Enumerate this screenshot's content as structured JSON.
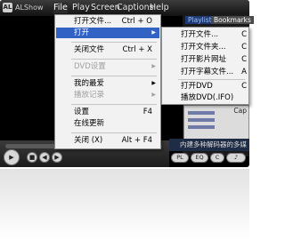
{
  "app": {
    "logo_text": "AL",
    "title": "ALShow"
  },
  "menubar": {
    "file": "File",
    "play": "Play",
    "screen": "Screen",
    "captions": "Captions",
    "help": "Help"
  },
  "tabs": {
    "playlist": "Playlist",
    "bookmarks": "Bookmarks"
  },
  "eq": {
    "cap": "Cap"
  },
  "info": {
    "scroll_text": "内建多种解码器的多媒"
  },
  "controls": {
    "pl": "PL",
    "eq": "EQ",
    "c": "C"
  },
  "file_menu": {
    "items": [
      {
        "label": "打开文件...",
        "shortcut": "Ctrl + O"
      },
      {
        "label": "打开",
        "shortcut": ""
      },
      {
        "label": "关闭文件",
        "shortcut": "Ctrl + X"
      },
      {
        "label": "DVD设置",
        "shortcut": ""
      },
      {
        "label": "我的最爱",
        "shortcut": ""
      },
      {
        "label": "播放记录",
        "shortcut": ""
      },
      {
        "label": "设置",
        "shortcut": "F4"
      },
      {
        "label": "在线更新",
        "shortcut": ""
      },
      {
        "label": "关闭 (X)",
        "shortcut": "Alt + F4"
      }
    ]
  },
  "open_submenu": {
    "items": [
      {
        "label": "打开文件...",
        "shortcut": "C"
      },
      {
        "label": "打开文件夹...",
        "shortcut": "C"
      },
      {
        "label": "打开影片网址",
        "shortcut": "C"
      },
      {
        "label": "打开字幕文件...",
        "shortcut": "A"
      },
      {
        "label": "打开DVD",
        "shortcut": "C"
      },
      {
        "label": "播放DVD(.IFO)",
        "shortcut": ""
      }
    ]
  }
}
